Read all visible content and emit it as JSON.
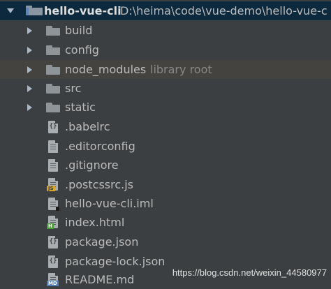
{
  "project": {
    "name": "hello-vue-cli",
    "path": "D:\\heima\\code\\vue-demo\\hello-vue-c",
    "icon": "project-folder-icon"
  },
  "items": [
    {
      "label": "build",
      "type": "folder",
      "icon": "folder-icon"
    },
    {
      "label": "config",
      "type": "folder",
      "icon": "folder-icon"
    },
    {
      "label": "node_modules",
      "type": "folder",
      "icon": "folder-icon",
      "extra": "library root"
    },
    {
      "label": "src",
      "type": "folder",
      "icon": "folder-icon"
    },
    {
      "label": "static",
      "type": "folder",
      "icon": "folder-icon"
    },
    {
      "label": ".babelrc",
      "type": "file",
      "icon": "config-file-icon"
    },
    {
      "label": ".editorconfig",
      "type": "file",
      "icon": "text-file-icon"
    },
    {
      "label": ".gitignore",
      "type": "file",
      "icon": "text-file-icon"
    },
    {
      "label": ".postcssrc.js",
      "type": "file",
      "icon": "js-file-icon",
      "badge": "JS"
    },
    {
      "label": "hello-vue-cli.iml",
      "type": "file",
      "icon": "iml-file-icon"
    },
    {
      "label": "index.html",
      "type": "file",
      "icon": "html-file-icon",
      "badge": "H"
    },
    {
      "label": "package.json",
      "type": "file",
      "icon": "json-file-icon"
    },
    {
      "label": "package-lock.json",
      "type": "file",
      "icon": "json-file-icon"
    },
    {
      "label": "README.md",
      "type": "file",
      "icon": "markdown-file-icon",
      "badge": "MD"
    }
  ],
  "watermark": "https://blog.csdn.net/weixin_44580977",
  "colors": {
    "background": "#3c3f41",
    "selected_row": "#0d293e",
    "highlight_row": "#45433f",
    "text": "#bbbbbb"
  }
}
